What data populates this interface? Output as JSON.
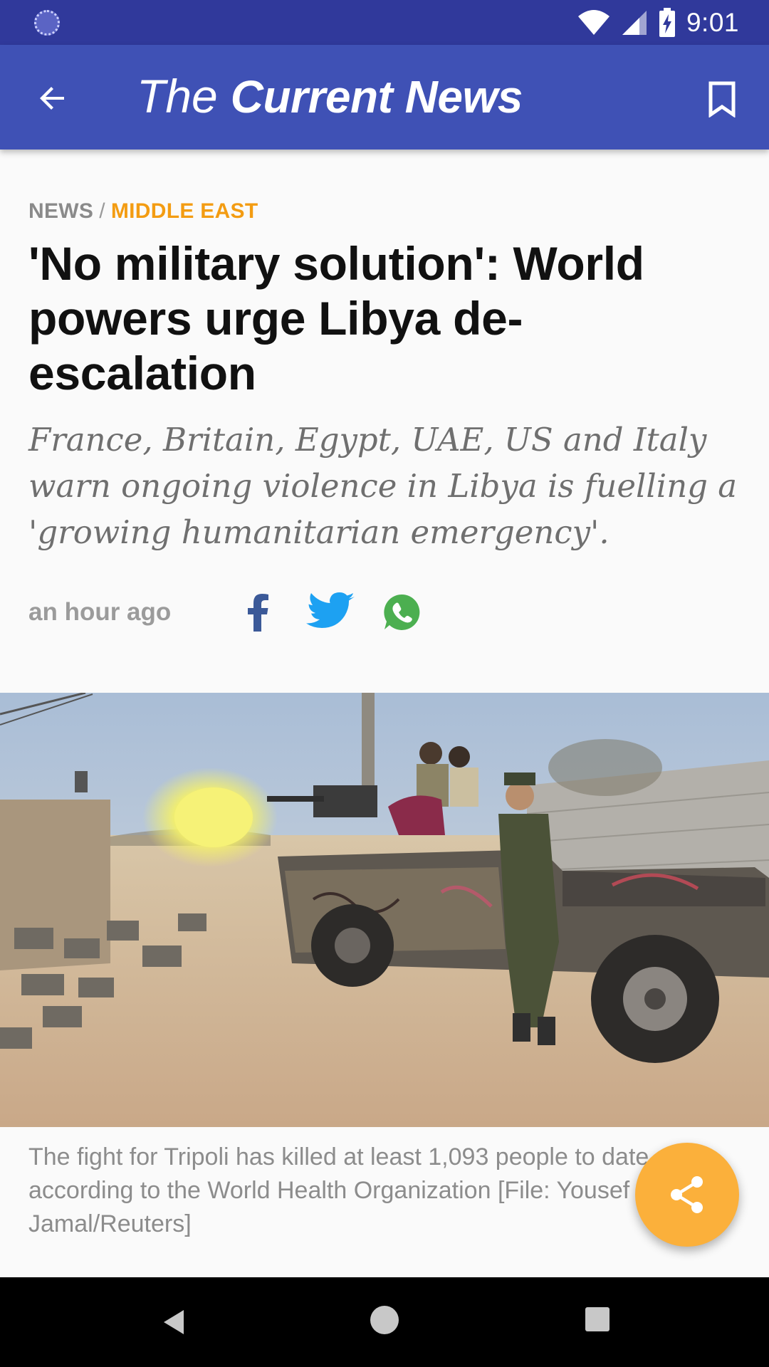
{
  "status_bar": {
    "time": "9:01",
    "icons": [
      "sync-icon",
      "wifi-icon",
      "cell-signal-icon",
      "battery-charging-icon"
    ]
  },
  "app_bar": {
    "brand_prefix": "The",
    "brand_name": "Current News",
    "back_icon": "arrow-back-icon",
    "bookmark_icon": "bookmark-outline-icon"
  },
  "article": {
    "breadcrumb": {
      "root": "NEWS",
      "separator": "/",
      "section": "MIDDLE EAST"
    },
    "headline": "'No military solution': World powers urge Libya de-escalation",
    "subtitle": "France, Britain, Egypt, UAE, US and Italy warn ongoing violence in Libya is fuelling a 'growing humanitarian emergency'.",
    "published": "an hour ago",
    "share_icons": [
      "facebook-icon",
      "twitter-icon",
      "whatsapp-icon"
    ],
    "image_caption": "The fight for Tripoli has killed at least 1,093 people to date, according to the World Health Organization [File: Yousef Jamal/Reuters]"
  },
  "fab": {
    "icon": "share-icon"
  },
  "nav_bar": {
    "icons": [
      "nav-back-icon",
      "nav-home-icon",
      "nav-recents-icon"
    ]
  },
  "colors": {
    "status_bar": "#30399b",
    "app_bar": "#3f51b5",
    "section_accent": "#f39c12",
    "fab": "#fbb03b",
    "facebook": "#3b5998",
    "twitter": "#1da1f2",
    "whatsapp": "#4caf50"
  }
}
